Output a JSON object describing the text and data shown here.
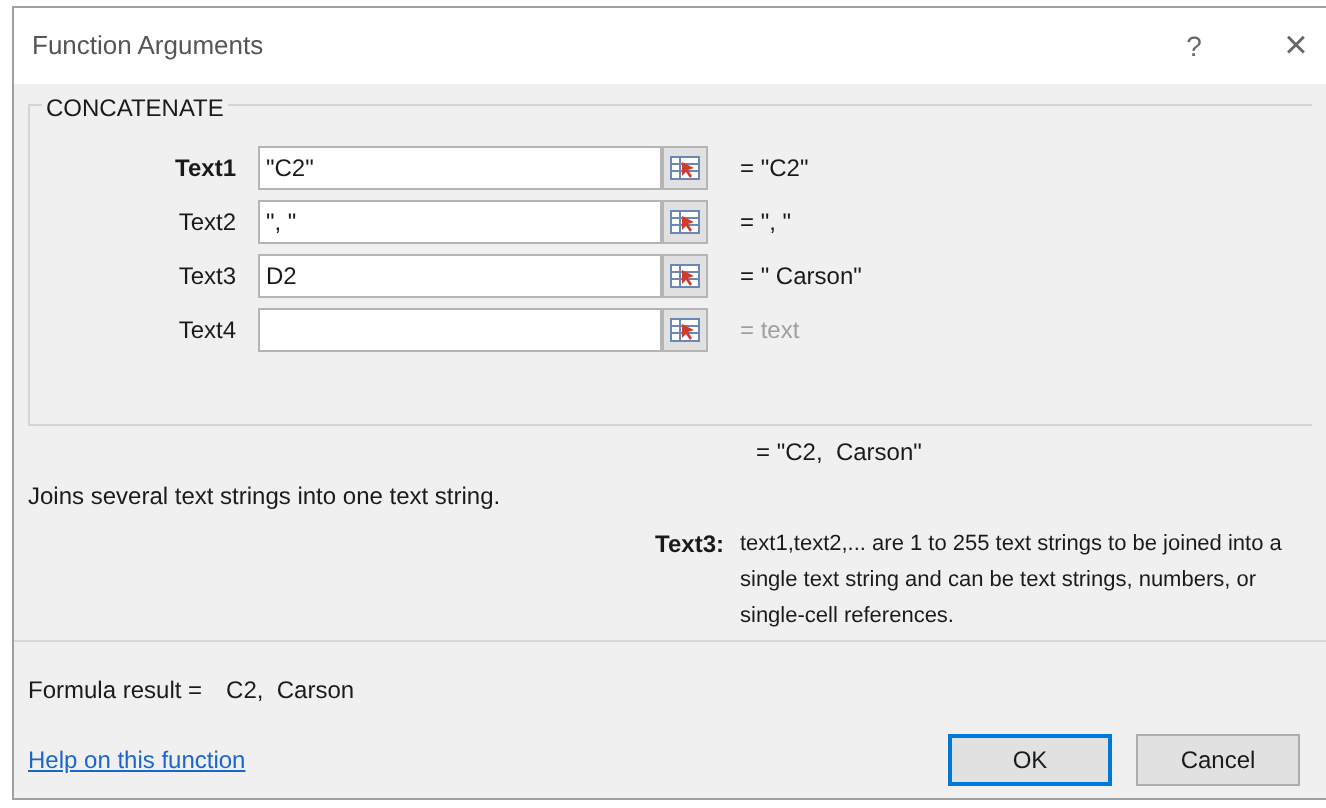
{
  "window": {
    "title": "Function Arguments",
    "help": "?",
    "close": "×"
  },
  "function_name": "CONCATENATE",
  "arguments": [
    {
      "label": "Text1",
      "value": "\"C2\"",
      "result": "= \"C2\"",
      "selected": true,
      "result_is_hint": false
    },
    {
      "label": "Text2",
      "value": "\", \"",
      "result": "= \", \"",
      "selected": false,
      "result_is_hint": false
    },
    {
      "label": "Text3",
      "value": "D2",
      "result": "= \" Carson\"",
      "selected": false,
      "result_is_hint": false
    },
    {
      "label": "Text4",
      "result": "= text",
      "selected": false,
      "result_is_hint": true
    }
  ],
  "overall_result": "= \"C2,  Carson\"",
  "description": "Joins several text strings into one text string.",
  "argument_help": {
    "label": "Text3:",
    "text": "text1,text2,... are 1 to 255 text strings to be joined into a single text string and can be text strings, numbers, or single-cell references."
  },
  "formula_result": {
    "label": "Formula result =",
    "value": "C2,  Carson"
  },
  "help_link": "Help on this function",
  "buttons": [
    {
      "label": "OK",
      "default": true
    },
    {
      "label": "Cancel",
      "default": false
    }
  ]
}
